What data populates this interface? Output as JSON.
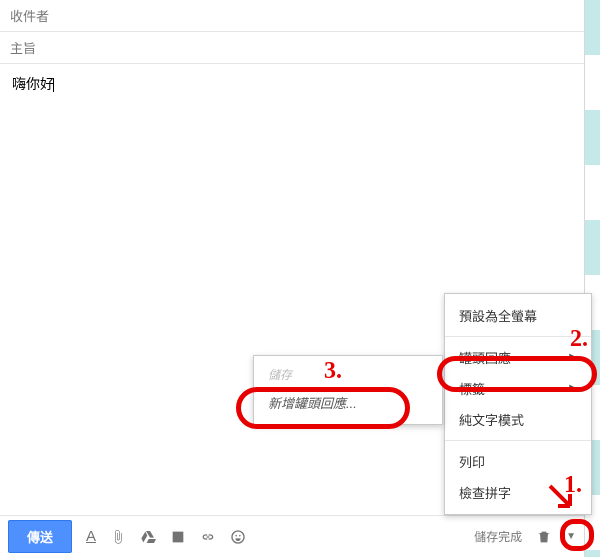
{
  "fields": {
    "recipient_placeholder": "收件者",
    "subject_placeholder": "主旨"
  },
  "body": {
    "text": "嗨你好"
  },
  "toolbar": {
    "send": "傳送",
    "save_status": "儲存完成"
  },
  "more_menu": {
    "fullscreen": "預設為全螢幕",
    "canned": "罐頭回應",
    "labels": "標籤",
    "plaintext": "純文字模式",
    "print": "列印",
    "spell": "檢查拼字"
  },
  "sub_menu": {
    "head": "儲存",
    "new_canned": "新增罐頭回應..."
  },
  "annotations": {
    "n1": "1.",
    "n2": "2.",
    "n3": "3."
  }
}
